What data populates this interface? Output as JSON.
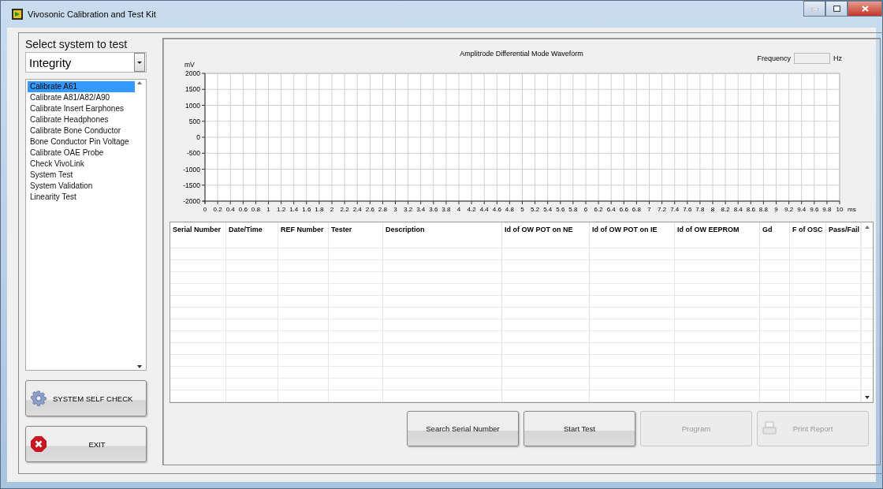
{
  "window": {
    "title": "Vivosonic Calibration and Test Kit"
  },
  "selector": {
    "label": "Select system to test",
    "value": "Integrity"
  },
  "tests": [
    {
      "label": "Calibrate A61",
      "selected": true
    },
    {
      "label": "Calibrate A81/A82/A90",
      "selected": false
    },
    {
      "label": "Calibrate Insert Earphones",
      "selected": false
    },
    {
      "label": "Calibrate Headphones",
      "selected": false
    },
    {
      "label": "Calibrate Bone Conductor",
      "selected": false
    },
    {
      "label": "Bone Conductor Pin Voltage",
      "selected": false
    },
    {
      "label": "Calibrate OAE Probe",
      "selected": false
    },
    {
      "label": "Check VivoLink",
      "selected": false
    },
    {
      "label": "System Test",
      "selected": false
    },
    {
      "label": "System Validation",
      "selected": false
    },
    {
      "label": "Linearity Test",
      "selected": false
    }
  ],
  "side_buttons": [
    {
      "label": "SYSTEM SELF CHECK",
      "kind": "gear"
    },
    {
      "label": "EXIT",
      "kind": "stop"
    }
  ],
  "waveform": {
    "frequency_label": "Frequency",
    "frequency_unit": "Hz",
    "chart_data": {
      "type": "line",
      "grid": true,
      "title": "Amplitrode Differential Mode Waveform",
      "xlabel": "ms",
      "ylabel": "mV",
      "xlim": [
        0,
        10
      ],
      "ylim": [
        -2000,
        2000
      ],
      "xticks": [
        0,
        0.2,
        0.4,
        0.6,
        0.8,
        1,
        1.2,
        1.4,
        1.6,
        1.8,
        2,
        2.2,
        2.4,
        2.6,
        2.8,
        3,
        3.2,
        3.4,
        3.6,
        3.8,
        4,
        4.2,
        4.4,
        4.6,
        4.8,
        5,
        5.2,
        5.4,
        5.6,
        5.8,
        6,
        6.2,
        6.4,
        6.6,
        6.8,
        7,
        7.2,
        7.4,
        7.6,
        7.8,
        8,
        8.2,
        8.4,
        8.6,
        8.8,
        9,
        9.2,
        9.4,
        9.6,
        9.8,
        10
      ],
      "yticks": [
        2000,
        1500,
        1000,
        500,
        0,
        -500,
        -1000,
        -1500,
        -2000
      ]
    }
  },
  "table": {
    "columns": [
      "Serial Number",
      "Date/Time",
      "REF Number",
      "Tester",
      "Description",
      "Id of OW POT on NE",
      "Id of OW POT on IE",
      "Id of OW EEPROM",
      "Gd",
      "F of OSC",
      "Pass/Fail"
    ]
  },
  "actions": [
    {
      "label": "Search Serial Number",
      "disabled": false,
      "kind": "plain"
    },
    {
      "label": "Start Test",
      "disabled": false,
      "kind": "plain"
    },
    {
      "label": "Program",
      "disabled": true,
      "kind": "plain"
    },
    {
      "label": "Print Report",
      "disabled": true,
      "kind": "printer"
    }
  ]
}
